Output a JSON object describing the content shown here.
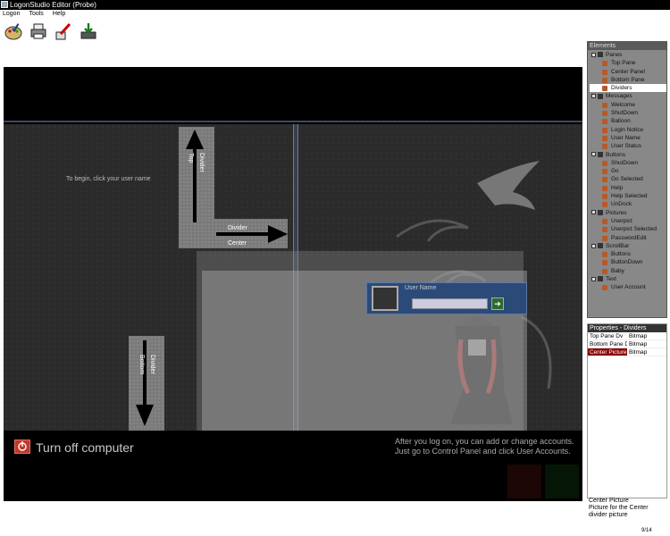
{
  "window": {
    "title": "LogonStudio Editor (Probe)"
  },
  "menu": [
    "Logon",
    "Tools",
    "Help"
  ],
  "toolbar": [
    {
      "name": "palette-icon"
    },
    {
      "name": "printer-icon"
    },
    {
      "name": "brush-icon"
    },
    {
      "name": "install-icon"
    }
  ],
  "preview": {
    "begin_text": "To begin, click your user name",
    "divider_top_label": "Divider\nTop",
    "divider_right_label": "Divider\nCenter",
    "divider_bottom_label": "Divider\nBottom",
    "user_tile": {
      "name": "User Name"
    },
    "turn_off_label": "Turn off computer",
    "info_line1": "After you log on, you can add or change accounts.",
    "info_line2": "Just go to Control Panel and click User Accounts."
  },
  "elements_panel": {
    "title": "Elements",
    "groups": [
      {
        "label": "Panes",
        "items": [
          "Top Pane",
          "Center Panel",
          "Bottom Pane",
          "Dividers"
        ]
      },
      {
        "label": "Messages",
        "items": [
          "Welcome",
          "ShutDown",
          "Balloon",
          "Login Notice",
          "User Name",
          "User Status"
        ]
      },
      {
        "label": "Buttons",
        "items": [
          "ShutDown",
          "Go",
          "Go Selected",
          "Help",
          "Help Selected",
          "UnDock"
        ]
      },
      {
        "label": "Pictures",
        "items": [
          "Userpict",
          "Userpict Selected",
          "PasswordEdit"
        ]
      },
      {
        "label": "ScrollBar",
        "items": [
          "Buttons",
          "ButtonDown",
          "Baby"
        ]
      },
      {
        "label": "Text",
        "items": [
          "User Account"
        ]
      }
    ],
    "selected": "Dividers"
  },
  "properties_panel": {
    "title": "Properties - Dividers",
    "rows": [
      {
        "key": "Top Pane Dv",
        "value": "Bitmap"
      },
      {
        "key": "Bottom Pane Dv",
        "value": "Bitmap"
      },
      {
        "key": "Center Picture",
        "value": "Bitmap"
      }
    ],
    "selected_row": "Center Picture"
  },
  "description": {
    "title": "Center Picture",
    "text": "Picture for the Center divider picture"
  },
  "status": "9/14",
  "colors": {
    "selection": "#800000",
    "panel_bg": "#888888",
    "tile": "#2b4a78"
  }
}
